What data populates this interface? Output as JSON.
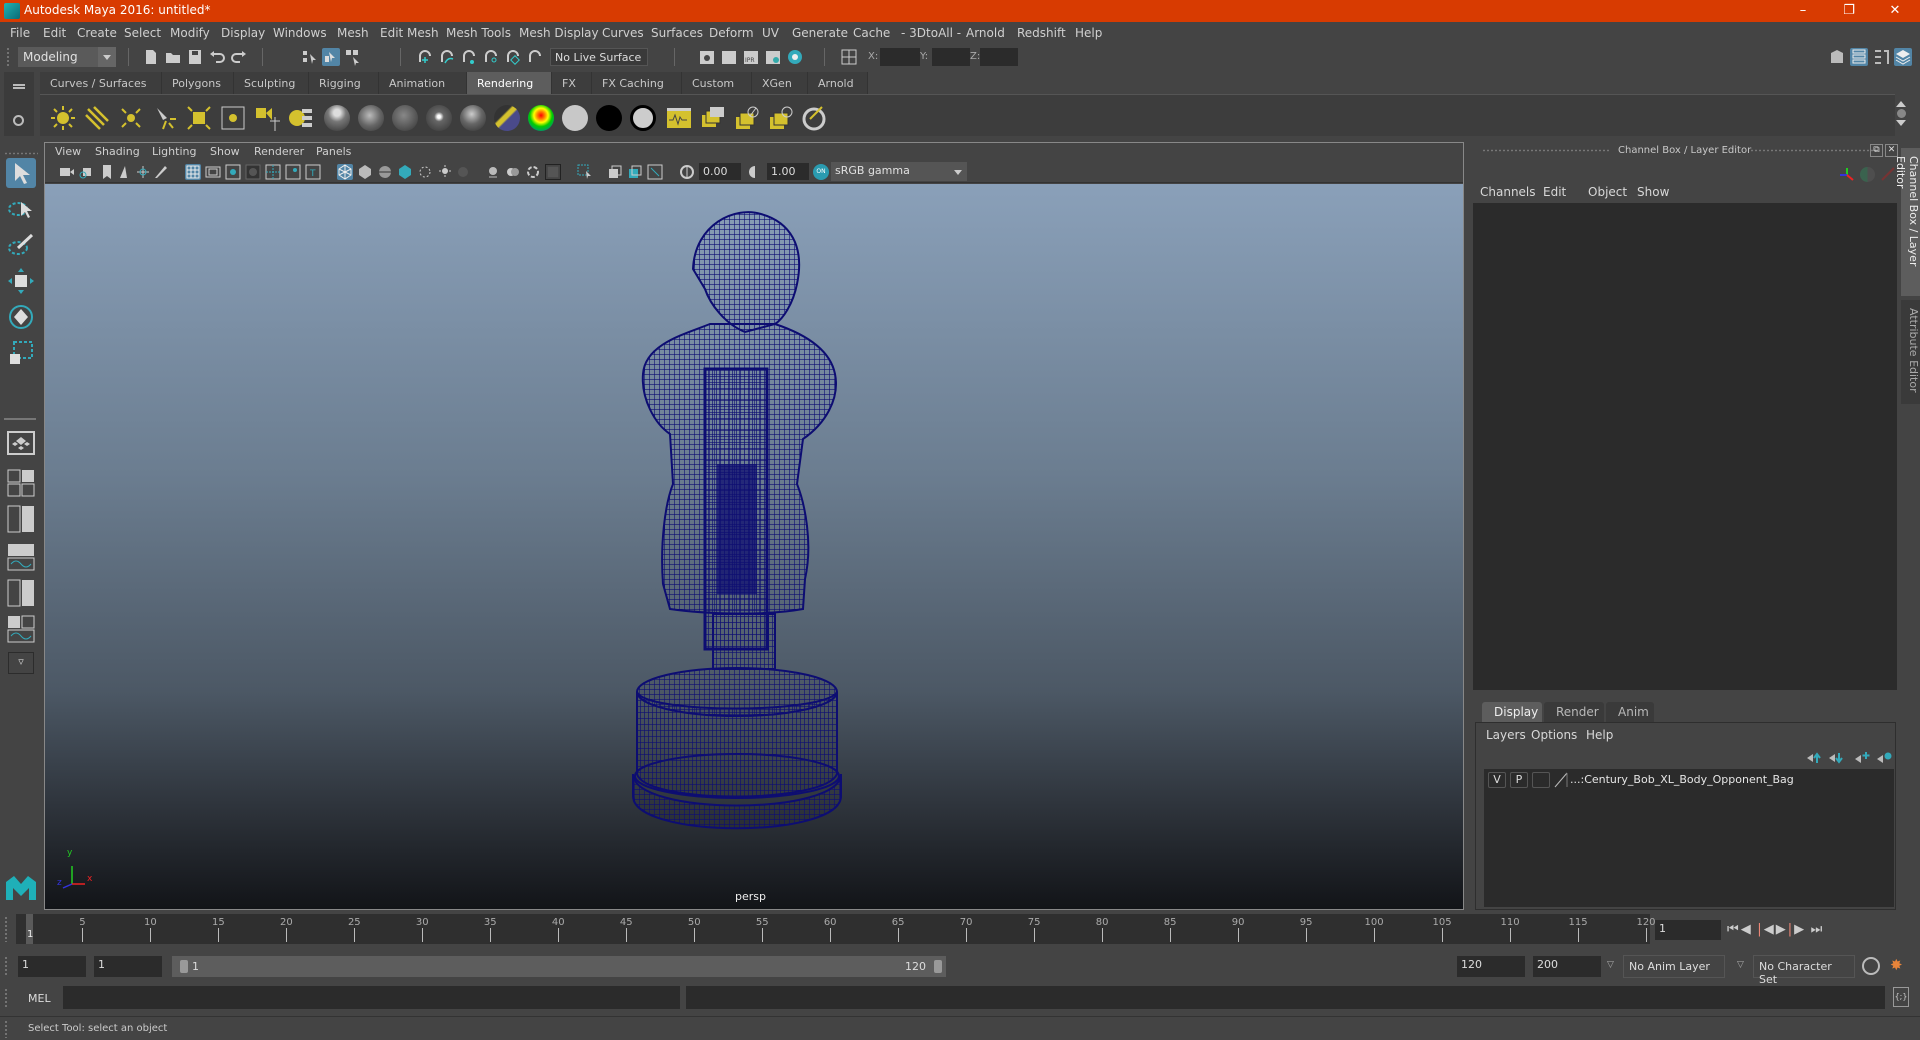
{
  "window": {
    "title": "Autodesk Maya 2016: untitled*",
    "controls": [
      "minimize",
      "restore",
      "close"
    ]
  },
  "menubar": {
    "items": [
      "File",
      "Edit",
      "Create",
      "Select",
      "Modify",
      "Display",
      "Windows",
      "Mesh",
      "Edit Mesh",
      "Mesh Tools",
      "Mesh Display",
      "Curves",
      "Surfaces",
      "Deform",
      "UV",
      "Generate",
      "Cache",
      "- 3DtoAll -",
      "Arnold",
      "Redshift",
      "Help"
    ]
  },
  "statusline": {
    "menuset": "Modeling",
    "live_surface": "No Live Surface",
    "x_label": "X:",
    "y_label": "Y:",
    "z_label": "Z:",
    "x_value": "",
    "y_value": "",
    "z_value": ""
  },
  "shelf": {
    "tabs": [
      "Curves / Surfaces",
      "Polygons",
      "Sculpting",
      "Rigging",
      "Animation",
      "Rendering",
      "FX",
      "FX Caching",
      "Custom",
      "XGen",
      "Arnold"
    ],
    "active_tab": "Rendering",
    "icons": [
      "ambient-light",
      "directional-light",
      "point-light",
      "spot-light",
      "area-light",
      "volume-light",
      "create-light-set",
      "light-editor",
      "blinn-material",
      "phong-material",
      "lambert-material",
      "phongE-material",
      "anisotropic-material",
      "layered-shader",
      "ramp-shader",
      "surface-shader-grey",
      "use-background-black",
      "surface-shader-outline",
      "render-settings-panel",
      "render-current-frame",
      "render-view",
      "ipr-render",
      "render-sequence"
    ]
  },
  "viewport": {
    "menus": [
      "View",
      "Shading",
      "Lighting",
      "Show",
      "Renderer",
      "Panels"
    ],
    "exposure": "0.00",
    "gamma": "1.00",
    "color_space": "sRGB gamma",
    "camera_label": "persp",
    "axis": {
      "x": "x",
      "y": "y",
      "z": "z"
    },
    "model_wireframe_color": "#0d0d72"
  },
  "channel_box": {
    "title": "Channel Box / Layer Editor",
    "menus": [
      "Channels",
      "Edit",
      "Object",
      "Show"
    ]
  },
  "layer_editor": {
    "tabs": [
      "Display",
      "Render",
      "Anim"
    ],
    "active_tab": "Display",
    "menus": [
      "Layers",
      "Options",
      "Help"
    ],
    "layers": [
      {
        "visible": "V",
        "playback": "P",
        "name": "...:Century_Bob_XL_Body_Opponent_Bag"
      }
    ]
  },
  "side_tabs": [
    "Channel Box / Layer Editor",
    "Attribute Editor"
  ],
  "timeline": {
    "ticks": [
      5,
      10,
      15,
      20,
      25,
      30,
      35,
      40,
      45,
      50,
      55,
      60,
      65,
      70,
      75,
      80,
      85,
      90,
      95,
      100,
      105,
      110,
      115,
      120
    ],
    "current_frame_marker": "1",
    "current_frame": "1",
    "min": 1,
    "max": 120
  },
  "range_slider": {
    "start_time": "1",
    "playback_start": "1",
    "range_start_label": "1",
    "range_end_label": "120",
    "playback_end": "120",
    "end_time": "200",
    "anim_layer": "No Anim Layer",
    "character_set": "No Character Set"
  },
  "command_line": {
    "label": "MEL",
    "value": ""
  },
  "help_line": {
    "text": "Select Tool: select an object"
  },
  "colors": {
    "title_bar": "#d83b01",
    "accent_blue": "#5285a6",
    "shelf_yellow": "#d4c12e"
  }
}
